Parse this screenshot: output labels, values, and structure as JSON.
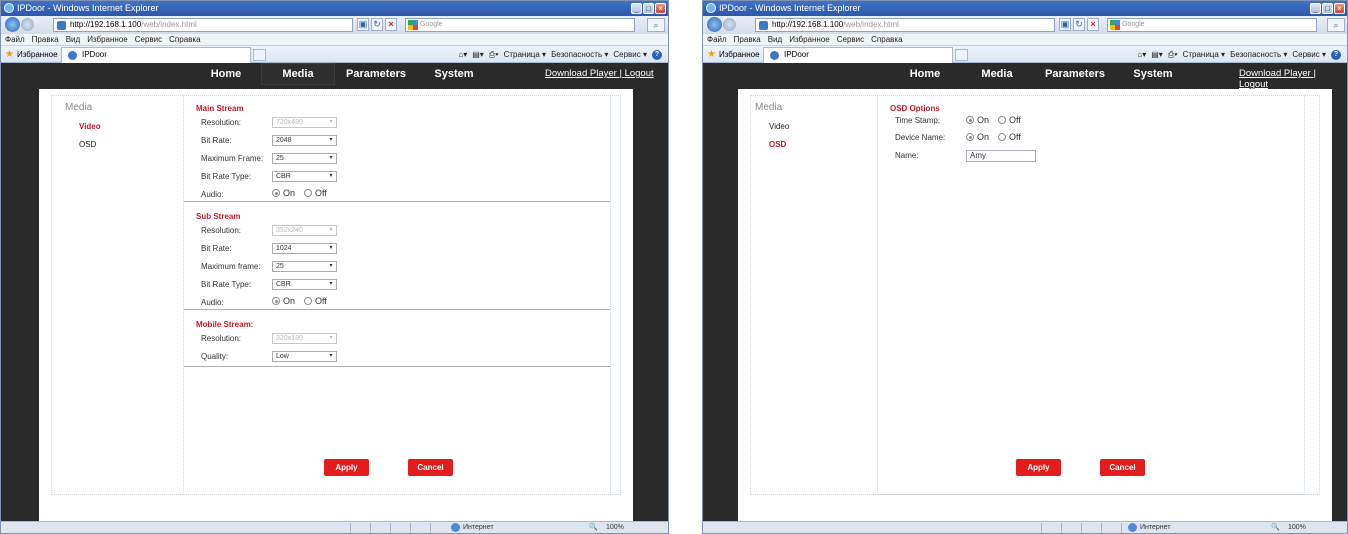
{
  "left": {
    "window_title": "IPDoor - Windows Internet Explorer",
    "address_host": "http://192.168.1.100",
    "address_path": "/web/index.html",
    "search_placeholder": "Google",
    "menu": [
      "Файл",
      "Правка",
      "Вид",
      "Избранное",
      "Сервис",
      "Справка"
    ],
    "favorites_label": "Избранное",
    "tab_title": "IPDoor",
    "cmd": [
      "Страница ▾",
      "Безопасность ▾",
      "Сервис ▾"
    ],
    "nav": [
      "Home",
      "Media",
      "Parameters",
      "System"
    ],
    "nav_active": "Media",
    "download_player": "Download Player",
    "logout": "Logout",
    "sidebar": {
      "title": "Media",
      "items": [
        "Video",
        "OSD"
      ],
      "active": "Video"
    },
    "main_stream": {
      "title": "Main Stream",
      "resolution_label": "Resolution:",
      "resolution": "720x480",
      "bitrate_label": "Bit Rate:",
      "bitrate": "2048",
      "maxframe_label": "Maximum Frame:",
      "maxframe": "25",
      "bitrate_type_label": "Bit Rate Type:",
      "bitrate_type": "CBR",
      "audio_label": "Audio:",
      "audio": "On"
    },
    "sub_stream": {
      "title": "Sub Stream",
      "resolution_label": "Resolution:",
      "resolution": "352x240",
      "bitrate_label": "Bit Rate:",
      "bitrate": "1024",
      "maxframe_label": "Maximum frame:",
      "maxframe": "25",
      "bitrate_type_label": "Bit Rate Type:",
      "bitrate_type": "CBR",
      "audio_label": "Audio:",
      "audio": "On"
    },
    "mobile_stream": {
      "title": "Mobile Stream:",
      "resolution_label": "Resolution:",
      "resolution": "320x180",
      "quality_label": "Quality:",
      "quality": "Low"
    },
    "radio_on": "On",
    "radio_off": "Off",
    "apply": "Apply",
    "cancel": "Cancel",
    "status_zone": "Интернет",
    "zoom": "100%"
  },
  "right": {
    "window_title": "IPDoor - Windows Internet Explorer",
    "address_host": "http://192.168.1.100",
    "address_path": "/web/index.html",
    "search_placeholder": "Google",
    "menu": [
      "Файл",
      "Правка",
      "Вид",
      "Избранное",
      "Сервис",
      "Справка"
    ],
    "favorites_label": "Избранное",
    "tab_title": "IPDoor",
    "cmd": [
      "Страница ▾",
      "Безопасность ▾",
      "Сервис ▾"
    ],
    "nav": [
      "Home",
      "Media",
      "Parameters",
      "System"
    ],
    "download_player": "Download Player",
    "logout": "Logout",
    "sidebar": {
      "title": "Media",
      "items": [
        "Video",
        "OSD"
      ],
      "active": "OSD"
    },
    "osd": {
      "title": "OSD Options",
      "timestamp_label": "Time Stamp:",
      "timestamp": "On",
      "devicename_label": "Device Name:",
      "devicename": "On",
      "name_label": "Name:",
      "name": "Amy"
    },
    "radio_on": "On",
    "radio_off": "Off",
    "apply": "Apply",
    "cancel": "Cancel",
    "status_zone": "Интернет",
    "zoom": "100%"
  },
  "colors": {
    "accent_red": "#e31c1c",
    "section_title": "#c8182a",
    "header_bg": "#2a2a2a"
  },
  "icons": [
    "ie-icon",
    "back-icon",
    "forward-icon",
    "refresh-icon",
    "stop-icon",
    "google-icon",
    "search-icon",
    "favorites-star-icon",
    "home-icon",
    "print-icon",
    "help-icon",
    "globe-icon"
  ]
}
